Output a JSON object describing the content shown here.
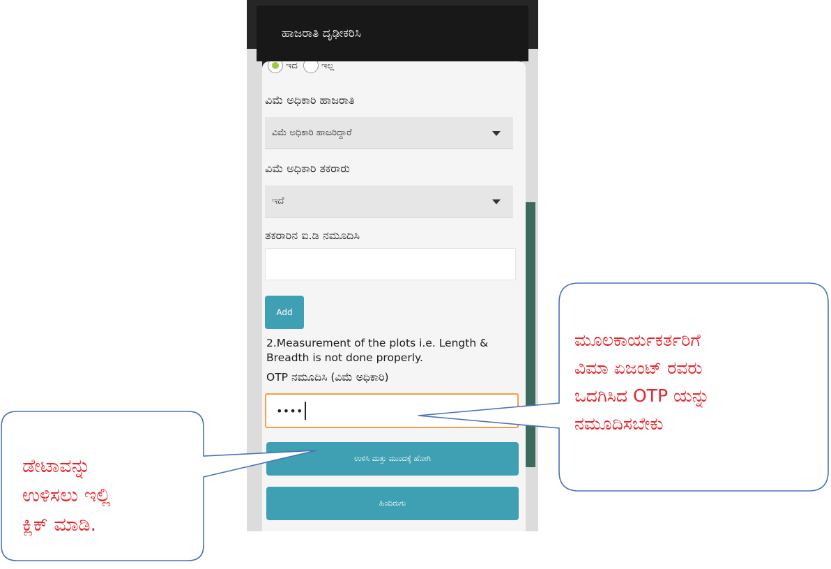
{
  "dialog": {
    "title": "ಹಾಜರಾತಿ ದೃಢೀಕರಿಸಿ",
    "radio_yes": "ಇದ",
    "radio_no": "ಇಲ್ಲ",
    "attendance_label": "ವಿಮೆ ಅಧಿಕಾರಿ ಹಾಜರಾತಿ",
    "attendance_value": "ವಿಮೆ ಅಧಿಕಾರಿ ಹಾಜರಿದ್ದಾರೆ",
    "complaint_label": "ವಿಮೆ ಅಧಿಕಾರಿ ತಕರಾರು",
    "complaint_value": "ಇದೆ",
    "complaint_id_label": "ತಕರಾರಿನ ಐ.ಡಿ ನಮೂದಿಸಿ",
    "complaint_id_value": "",
    "add_button": "Add",
    "complaint_text": "2.Measurement of the plots i.e. Length & Breadth is not done properly.",
    "otp_label": "OTP ನಮೂದಿಸಿ (ವಿಮೆ ಅಧಿಕಾರಿ)",
    "otp_value": "••••",
    "save_button": "ಉಳಿಸಿ ಮತ್ತು ಮುಂದಕ್ಕೆ ಹೋಗಿ",
    "back_button": "ಹಿಂದಿರುಗು"
  },
  "callouts": {
    "left": [
      "ಡೇಟಾವನ್ನು",
      "ಉಳಿಸಲು ಇಲ್ಲಿ",
      "ಕ್ಲಿಕ್ ಮಾಡಿ."
    ],
    "right": [
      "ಮೂಲಕಾರ್ಯಕರ್ತರಿಗೆ",
      "ವಿಮಾ ಏಜಂಟ್ ರವರು",
      "ಒದಗಿಸಿದ OTP ಯನ್ನು",
      "ನಮೂದಿಸಬೇಕು"
    ]
  },
  "colors": {
    "accent_teal": "#3fa0b4",
    "otp_border": "#f0a04a",
    "callout_text": "#e8242a",
    "callout_border": "#4a72b8"
  }
}
